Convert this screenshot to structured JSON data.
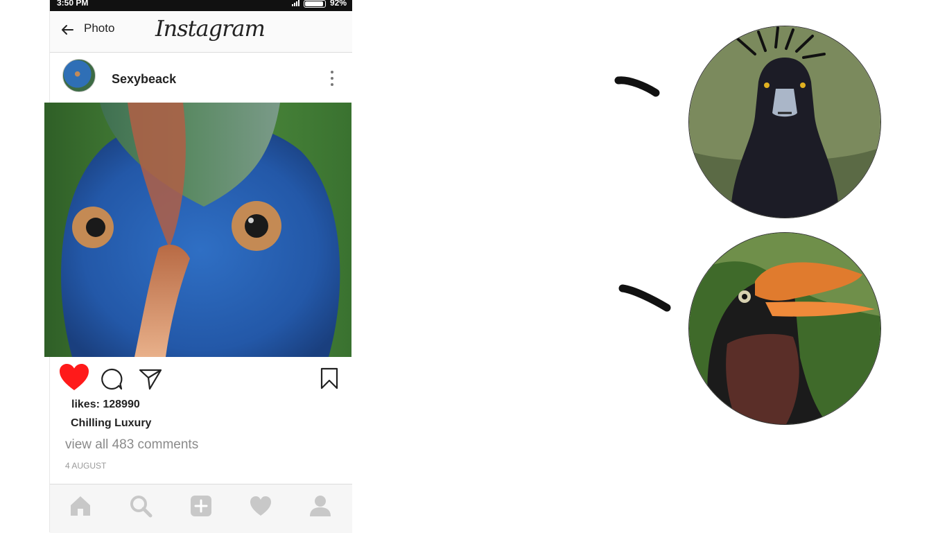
{
  "statusbar": {
    "time": "3:50 PM",
    "battery": "92%"
  },
  "header": {
    "back_label": "Photo",
    "app_name": "Instagram"
  },
  "post": {
    "username": "Sexybeack",
    "likes": "likes: 128990",
    "caption": "Chilling Luxury",
    "comments_link": "view all 483 comments",
    "date": "4 AUGUST"
  },
  "icons": {
    "back": "arrow-left-icon",
    "more": "more-vertical-icon",
    "like": "heart-filled-icon",
    "comment": "comment-bubble-icon",
    "share": "send-icon",
    "save": "bookmark-icon",
    "nav": [
      "home-icon",
      "search-icon",
      "add-post-icon",
      "activity-heart-icon",
      "profile-icon"
    ]
  },
  "colors": {
    "like": "#ff1a1a",
    "nav_icon": "#c8c8c8",
    "header_bg": "#fafafa"
  }
}
